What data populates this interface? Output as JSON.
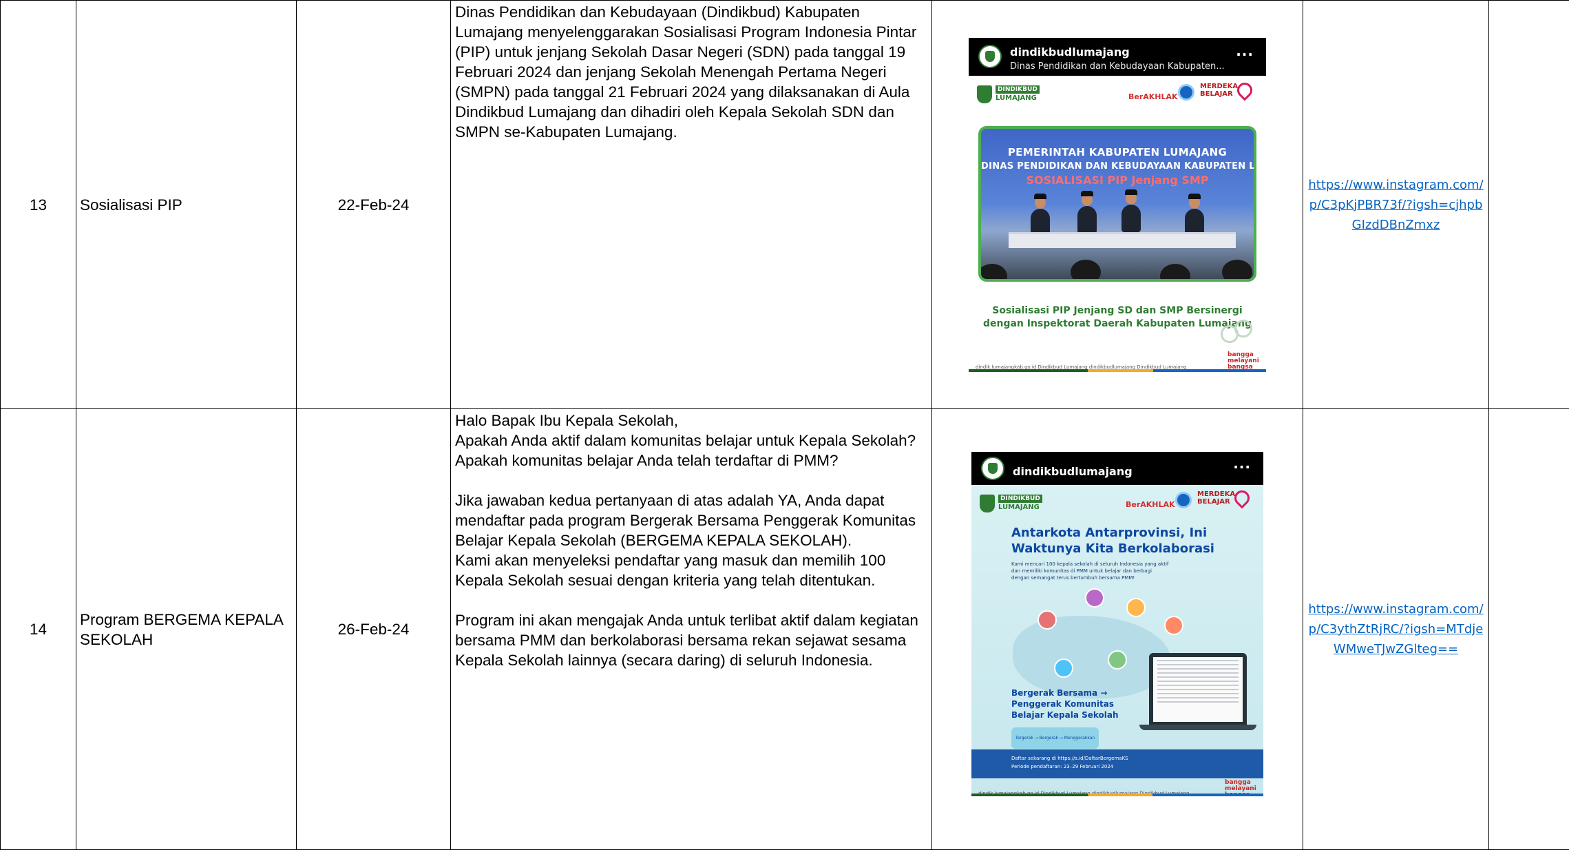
{
  "rows": [
    {
      "no": "13",
      "activity": "Sosialisasi PIP",
      "date": "22-Feb-24",
      "description": [
        "Dinas Pendidikan dan Kebudayaan (Dindikbud) Kabupaten Lumajang menyelenggarakan Sosialisasi Program Indonesia Pintar (PIP) untuk jenjang Sekolah Dasar Negeri (SDN) pada tanggal 19 Februari 2024 dan jenjang Sekolah Menengah Pertama Negeri (SMPN) pada tanggal 21 Februari 2024  yang dilaksanakan di Aula Dindikbud Lumajang dan dihadiri oleh Kepala Sekolah SDN dan SMPN se-Kabupaten Lumajang."
      ],
      "link": "https://www.instagram.com/p/C3pKjPBR73f/?igsh=cjhpbGIzdDBnZmxz",
      "post": {
        "username": "dindikbudlumajang",
        "subtitle": "Dinas Pendidikan dan Kebudayaan Kabupaten...",
        "more": "···",
        "logo_left_1": "DINDIKBUD",
        "logo_left_2": "LUMAJANG",
        "logo_right_1": "BerAKHLAK",
        "logo_right_2": "MERDEKA BELAJAR",
        "banner_1": "PEMERINTAH KABUPATEN LUMAJANG",
        "banner_2": "DINAS PENDIDIKAN DAN KEBUDAYAAN KABUPATEN LUMA",
        "banner_3": "SOSIALISASI PIP Jenjang SMP",
        "caption": "Sosialisasi PIP Jenjang SD dan SMP Bersinergi dengan Inspektorat Daerah Kabupaten Lumajang",
        "footer": "dindik.lumajangkab.go.id   Dindikbud Lumajang   dindikbudlumajang   Dindikbud Lumajang",
        "tag": "bangga melayani bangsa"
      }
    },
    {
      "no": "14",
      "activity": "Program BERGEMA KEPALA SEKOLAH",
      "date": "26-Feb-24",
      "description": [
        "Halo Bapak Ibu Kepala Sekolah,",
        "Apakah Anda aktif dalam komunitas belajar untuk Kepala Sekolah?",
        "Apakah komunitas belajar Anda telah terdaftar di PMM?",
        "Jika jawaban kedua pertanyaan di atas adalah YA, Anda dapat mendaftar pada program Bergerak Bersama Penggerak Komunitas Belajar Kepala Sekolah (BERGEMA KEPALA SEKOLAH).",
        "Kami akan menyeleksi pendaftar yang masuk dan memilih 100 Kepala Sekolah sesuai dengan kriteria yang telah ditentukan.",
        "Program ini akan mengajak Anda untuk terlibat aktif dalam kegiatan bersama PMM dan berkolaborasi bersama rekan sejawat sesama Kepala Sekolah lainnya (secara daring) di seluruh Indonesia."
      ],
      "link": "https://www.instagram.com/p/C3ythZtRjRC/?igsh=MTdjeWMweTJwZGlteg==",
      "post": {
        "username": "dindikbudlumajang",
        "more": "···",
        "logo_left_1": "DINDIKBUD",
        "logo_left_2": "LUMAJANG",
        "logo_right_1": "BerAKHLAK",
        "logo_right_2": "MERDEKA BELAJAR",
        "headline": "Antarkota Antarprovinsi, Ini Waktunya Kita Berkolaborasi",
        "body": "Kami mencari 100 kepala sekolah di seluruh Indonesia yang aktif dan memiliki komunitas di PMM untuk belajar dan berbagi dengan semangat terus bertumbuh bersama PMM!",
        "program": "Bergerak Bersama → Penggerak Komunitas Belajar Kepala Sekolah",
        "steps": "Tergerak → Bergerak → Menggerakkan",
        "register": "Daftar sekarang di https://s.id/DaftarBergemaKS",
        "period": "Periode pendaftaran: 23–29 Februari 2024",
        "footer": "dindik.lumajangkab.go.id   Dindikbud Lumajang   dindikbudlumajang   Dindikbud Lumajang",
        "tag": "bangga melayani bangsa"
      }
    }
  ]
}
